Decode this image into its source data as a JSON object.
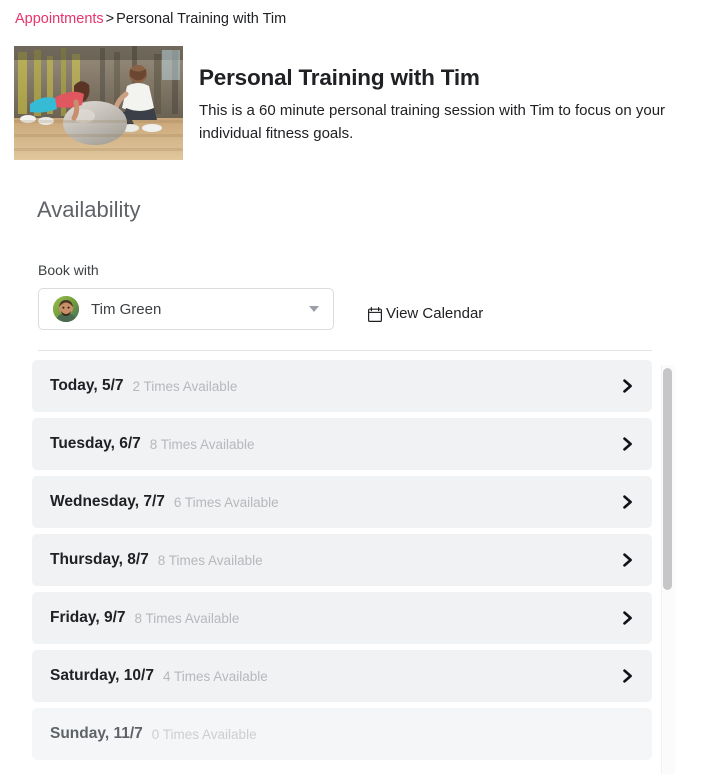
{
  "breadcrumb": {
    "link": "Appointments",
    "separator": ">",
    "current": "Personal Training with Tim"
  },
  "hero": {
    "image_alt": "gym-training-photo",
    "title": "Personal Training with Tim",
    "description": "This is a 60 minute personal training session with Tim to focus on your individual fitness goals."
  },
  "availability": {
    "heading": "Availability",
    "book_with_label": "Book with",
    "staff_select": {
      "value": "Tim Green",
      "avatar_alt": "tim-green-avatar",
      "caret_icon": "chevron-down-icon"
    },
    "view_calendar": {
      "label": "View Calendar",
      "icon": "calendar-icon"
    },
    "days": [
      {
        "name": "Today, 5/7",
        "times": "2 Times Available",
        "count": 2,
        "enabled": true,
        "chevron": "chevron-right-icon"
      },
      {
        "name": "Tuesday, 6/7",
        "times": "8 Times Available",
        "count": 8,
        "enabled": true,
        "chevron": "chevron-right-icon"
      },
      {
        "name": "Wednesday, 7/7",
        "times": "6 Times Available",
        "count": 6,
        "enabled": true,
        "chevron": "chevron-right-icon"
      },
      {
        "name": "Thursday, 8/7",
        "times": "8 Times Available",
        "count": 8,
        "enabled": true,
        "chevron": "chevron-right-icon"
      },
      {
        "name": "Friday, 9/7",
        "times": "8 Times Available",
        "count": 8,
        "enabled": true,
        "chevron": "chevron-right-icon"
      },
      {
        "name": "Saturday, 10/7",
        "times": "4 Times Available",
        "count": 4,
        "enabled": true,
        "chevron": "chevron-right-icon"
      },
      {
        "name": "Sunday, 11/7",
        "times": "0 Times Available",
        "count": 0,
        "enabled": false,
        "chevron": null
      }
    ]
  },
  "colors": {
    "link": "#e8336d",
    "row_background": "#f1f2f4",
    "row_background_disabled": "#f5f6f7",
    "muted_text": "#b6b8bc",
    "heading_text": "#5f6368"
  }
}
